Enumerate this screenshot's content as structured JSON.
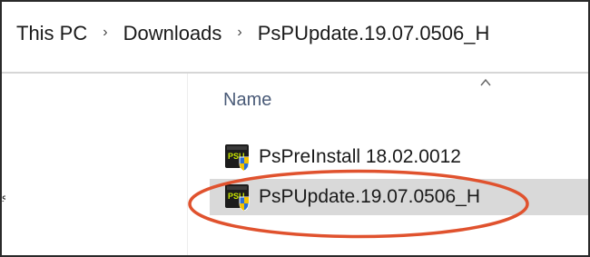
{
  "breadcrumb": {
    "items": [
      "This PC",
      "Downloads",
      "PsPUpdate.19.07.0506_H"
    ],
    "separator": "›"
  },
  "nav_pane": {
    "partial_label": "s"
  },
  "file_list": {
    "column_header": "Name",
    "sort_icon": "chevron-up-icon",
    "files": [
      {
        "name": "PsPreInstall 18.02.0012",
        "icon": "psu-app-icon",
        "selected": false
      },
      {
        "name": "PsPUpdate.19.07.0506_H",
        "icon": "psu-app-icon",
        "selected": true
      }
    ]
  },
  "annotation": {
    "type": "ellipse",
    "color": "#e0522e",
    "target": "PsPUpdate.19.07.0506_H"
  },
  "colors": {
    "selection_bg": "#d9d9d9",
    "header_text": "#4a5b78",
    "icon_bg": "#1c1c1c",
    "icon_accent": "#c8e600",
    "shield_blue": "#2b6fd6",
    "shield_yellow": "#f3c300"
  }
}
